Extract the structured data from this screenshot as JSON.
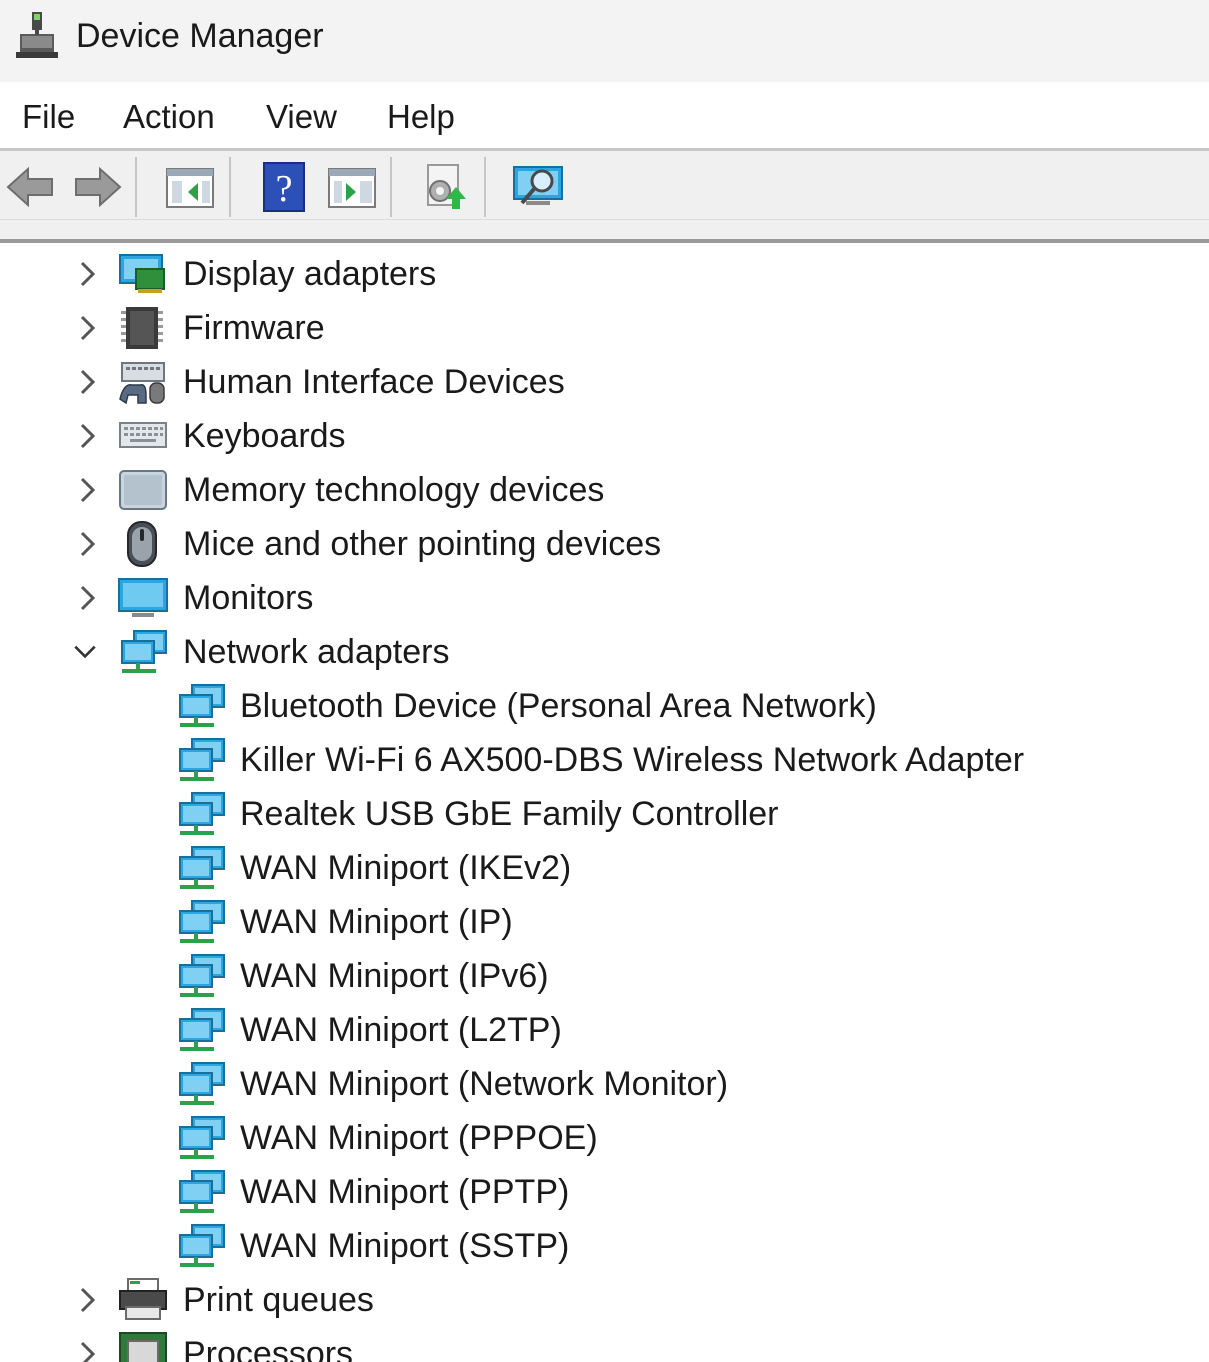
{
  "window": {
    "title": "Device Manager"
  },
  "menu": {
    "file": "File",
    "action": "Action",
    "view": "View",
    "help": "Help"
  },
  "toolbar": {
    "buttons": [
      "back-arrow-icon",
      "forward-arrow-icon",
      "show-hide-console-tree-icon",
      "help-icon",
      "action-pane-icon",
      "update-driver-icon",
      "scan-hardware-icon"
    ]
  },
  "tree": {
    "categories": [
      {
        "label": "Display adapters",
        "icon": "display-adapter-icon",
        "expanded": false
      },
      {
        "label": "Firmware",
        "icon": "firmware-chip-icon",
        "expanded": false
      },
      {
        "label": "Human Interface Devices",
        "icon": "hid-icon",
        "expanded": false
      },
      {
        "label": "Keyboards",
        "icon": "keyboard-icon",
        "expanded": false
      },
      {
        "label": "Memory technology devices",
        "icon": "memory-device-icon",
        "expanded": false
      },
      {
        "label": "Mice and other pointing devices",
        "icon": "mouse-icon",
        "expanded": false
      },
      {
        "label": "Monitors",
        "icon": "monitor-icon",
        "expanded": false
      },
      {
        "label": "Network adapters",
        "icon": "network-adapter-icon",
        "expanded": true,
        "children": [
          "Bluetooth Device (Personal Area Network)",
          "Killer Wi-Fi 6 AX500-DBS Wireless Network Adapter",
          "Realtek USB GbE Family Controller",
          "WAN Miniport (IKEv2)",
          "WAN Miniport (IP)",
          "WAN Miniport (IPv6)",
          "WAN Miniport (L2TP)",
          "WAN Miniport (Network Monitor)",
          "WAN Miniport (PPPOE)",
          "WAN Miniport (PPTP)",
          "WAN Miniport (SSTP)"
        ]
      },
      {
        "label": "Print queues",
        "icon": "printer-icon",
        "expanded": false
      },
      {
        "label": "Processors",
        "icon": "processor-icon",
        "expanded": false
      }
    ]
  },
  "colors": {
    "titlebar": "#f3f3f3",
    "toolbar": "#f0f0f0",
    "text": "#1a1a1a"
  }
}
